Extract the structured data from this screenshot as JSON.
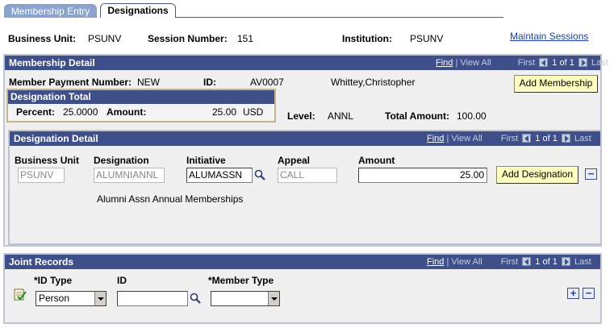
{
  "tabs": [
    {
      "label": "Membership Entry",
      "active": false
    },
    {
      "label": "Designations",
      "active": true
    }
  ],
  "header": {
    "business_unit_label": "Business Unit:",
    "business_unit_value": "PSUNV",
    "session_number_label": "Session Number:",
    "session_number_value": "151",
    "institution_label": "Institution:",
    "institution_value": "PSUNV",
    "maintain_sessions_link": "Maintain Sessions"
  },
  "membership_detail": {
    "title": "Membership Detail",
    "nav": {
      "find": "Find",
      "sep": " | ",
      "view_all": "View All",
      "first": "First",
      "pager": "1 of 1",
      "last": "Last"
    },
    "member_payment_number_label": "Member Payment Number:",
    "member_payment_number_value": "NEW",
    "id_label": "ID:",
    "id_value": "AV0007",
    "name_value": "Whittey,Christopher",
    "add_membership_button": "Add Membership",
    "level_label": "Level:",
    "level_value": "ANNL",
    "total_amount_label": "Total Amount:",
    "total_amount_value": "100.00",
    "designation_total": {
      "title": "Designation Total",
      "percent_label": "Percent:",
      "percent_value": "25.0000",
      "amount_label": "Amount:",
      "amount_value": "25.00",
      "currency": "USD"
    }
  },
  "designation_detail": {
    "title": "Designation Detail",
    "nav": {
      "find": "Find",
      "sep": " | ",
      "view_all": "View All",
      "first": "First",
      "pager": "1 of 1",
      "last": "Last"
    },
    "columns": {
      "business_unit": "Business Unit",
      "designation": "Designation",
      "initiative": "Initiative",
      "appeal": "Appeal",
      "amount": "Amount"
    },
    "row": {
      "business_unit": "PSUNV",
      "designation": "ALUMNIANNL",
      "initiative": "ALUMASSN",
      "appeal": "CALL",
      "amount": "25.00",
      "description": "Alumni Assn Annual Memberships"
    },
    "add_designation_button": "Add Designation",
    "remove_row_symbol": "−"
  },
  "joint_records": {
    "title": "Joint Records",
    "nav": {
      "find": "Find",
      "sep": " | ",
      "view_all": "View All",
      "first": "First",
      "pager": "1 of 1",
      "last": "Last"
    },
    "columns": {
      "id_type": "*ID Type",
      "id": "ID",
      "member_type": "*Member Type"
    },
    "row": {
      "id_type": "Person",
      "id": "",
      "member_type": ""
    },
    "add_row_symbol": "+",
    "remove_row_symbol": "−"
  },
  "colors": {
    "bar": "#3f4f8a",
    "button_bg": "#ffffbf",
    "link": "#1a3fa0"
  }
}
